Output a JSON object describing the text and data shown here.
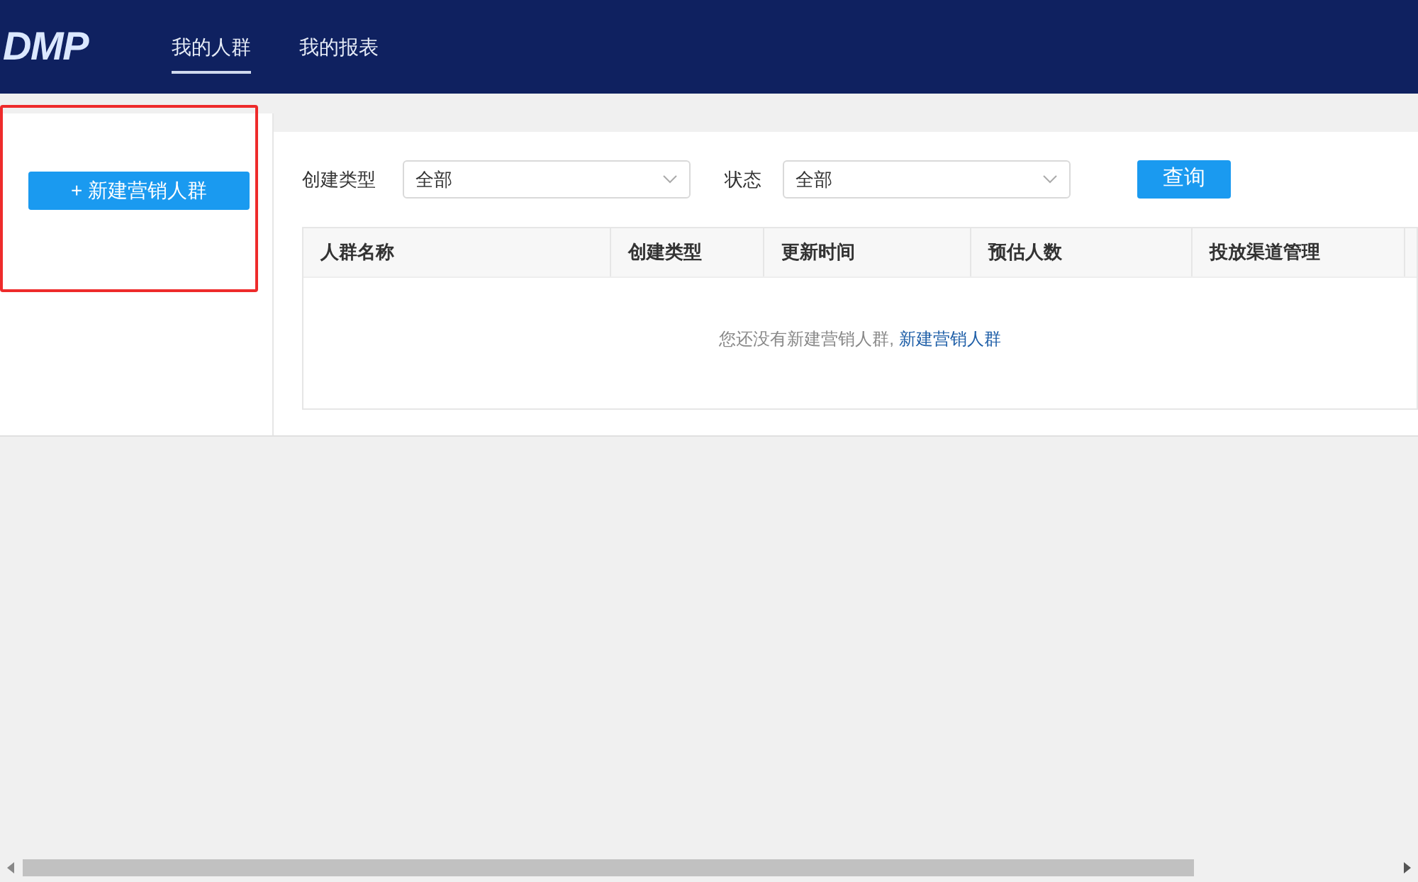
{
  "header": {
    "logo": "DMP",
    "nav": [
      {
        "label": "我的人群",
        "selected": true
      },
      {
        "label": "我的报表",
        "selected": false
      }
    ]
  },
  "sidebar": {
    "create_button": "+ 新建营销人群",
    "highlighted": true
  },
  "filters": [
    {
      "label": "创建类型",
      "value": "全部"
    },
    {
      "label": "状态",
      "value": "全部"
    }
  ],
  "query_button": "查询",
  "table": {
    "columns": [
      "人群名称",
      "创建类型",
      "更新时间",
      "预估人数",
      "投放渠道管理"
    ],
    "empty_text": "您还没有新建营销人群,",
    "empty_link": "新建营销人群"
  }
}
